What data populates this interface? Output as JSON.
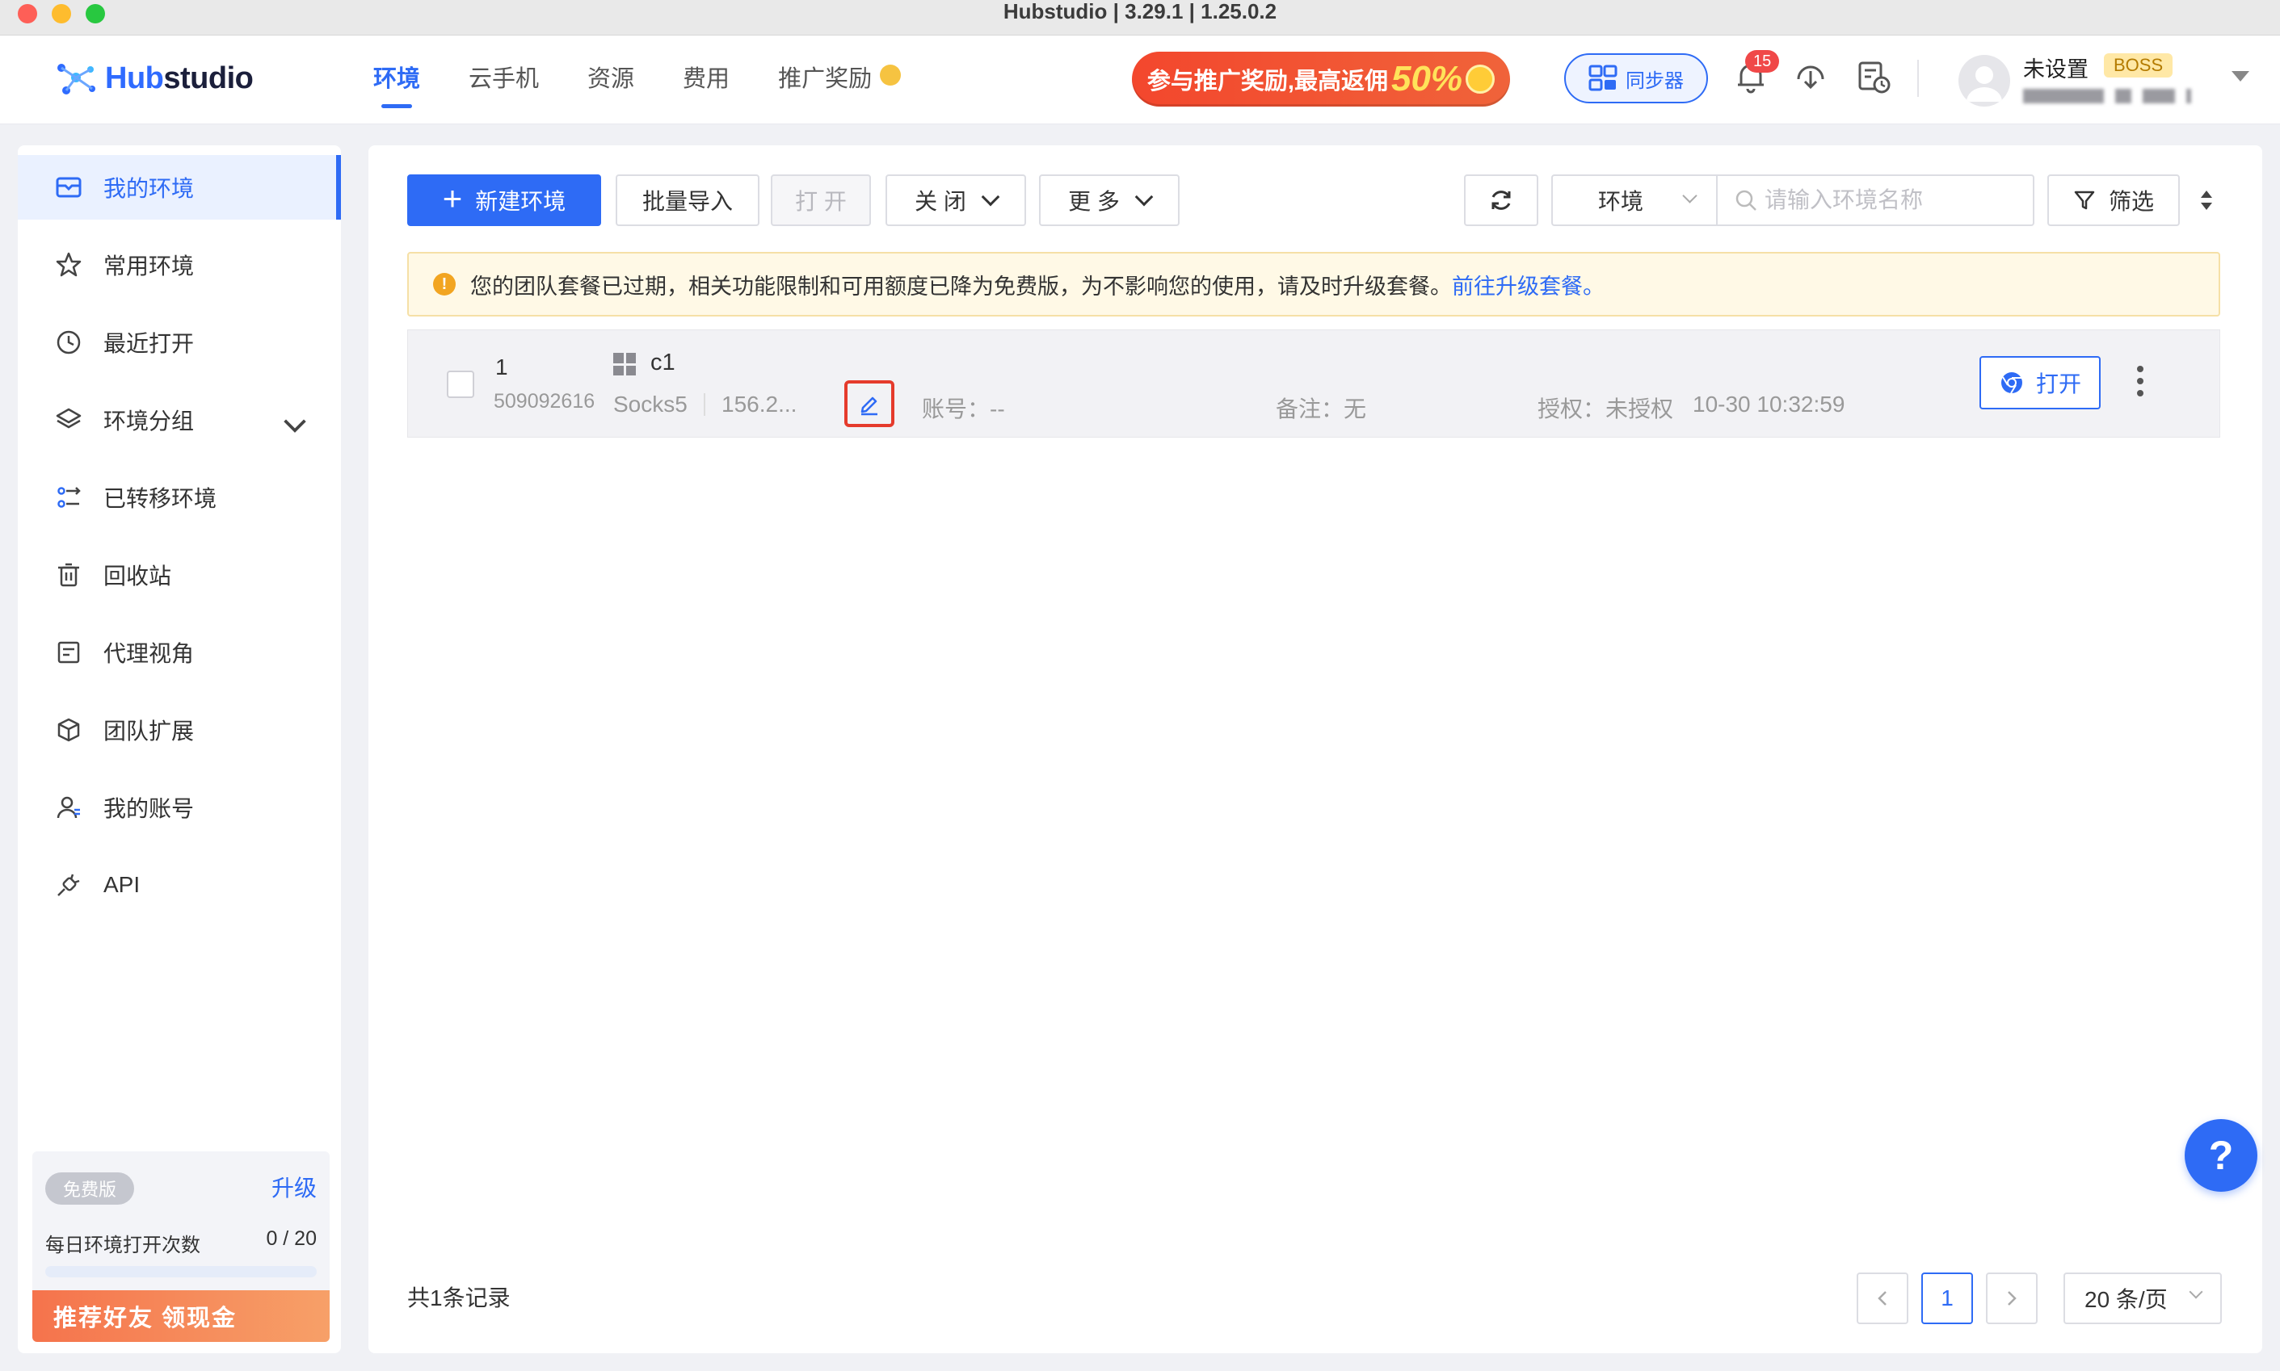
{
  "window": {
    "title": "Hubstudio | 3.29.1 | 1.25.0.2"
  },
  "brand": {
    "logo_hub": "Hub",
    "logo_studio": "studio"
  },
  "nav": {
    "tabs": [
      {
        "label": "环境",
        "active": true
      },
      {
        "label": "云手机",
        "active": false
      },
      {
        "label": "资源",
        "active": false
      },
      {
        "label": "费用",
        "active": false
      },
      {
        "label": "推广奖励",
        "active": false
      }
    ],
    "promo_text": "参与推广奖励,最高返佣",
    "promo_percent": "50%",
    "sync_label": "同步器",
    "notification_count": "15",
    "user_name": "未设置",
    "user_badge": "BOSS"
  },
  "sidebar": {
    "items": [
      {
        "label": "我的环境",
        "icon": "monitor-icon",
        "active": true
      },
      {
        "label": "常用环境",
        "icon": "star-icon"
      },
      {
        "label": "最近打开",
        "icon": "clock-icon"
      },
      {
        "label": "环境分组",
        "icon": "layers-icon",
        "expandable": true
      },
      {
        "label": "已转移环境",
        "icon": "transfer-icon"
      },
      {
        "label": "回收站",
        "icon": "trash-icon"
      },
      {
        "label": "代理视角",
        "icon": "proxy-view-icon"
      },
      {
        "label": "团队扩展",
        "icon": "cube-icon"
      },
      {
        "label": "我的账号",
        "icon": "user-icon"
      },
      {
        "label": "API",
        "icon": "plug-icon"
      }
    ],
    "plan": {
      "badge": "免费版",
      "upgrade_label": "升级",
      "open_count_label": "每日环境打开次数",
      "open_count_value": "0 / 20",
      "open_count_fraction": 0
    },
    "refer_banner": "推荐好友 领现金"
  },
  "toolbar": {
    "new_env": "新建环境",
    "batch_import": "批量导入",
    "open": "打 开",
    "close": "关 闭",
    "more": "更 多",
    "scope_select": "环境",
    "search_placeholder": "请输入环境名称",
    "filter": "筛选"
  },
  "notice": {
    "text": "您的团队套餐已过期，相关功能限制和可用额度已降为免费版，为不影响您的使用，请及时升级套餐。",
    "link": "前往升级套餐。"
  },
  "environments": [
    {
      "index": "1",
      "id": "509092616",
      "name": "c1",
      "proxy_type": "Socks5",
      "proxy_ip": "156.2...",
      "account": "账号：--",
      "remark": "备注：无",
      "auth": "授权：未授权",
      "time": "10-30 10:32:59",
      "open_label": "打开"
    }
  ],
  "footer": {
    "total": "共1条记录",
    "current_page": "1",
    "page_size": "20 条/页"
  },
  "help": "?",
  "colors": {
    "primary": "#2e6bf5",
    "promo": "#f3472d",
    "warning_bg": "#fff9e6",
    "highlight_border": "#e53b2c"
  }
}
